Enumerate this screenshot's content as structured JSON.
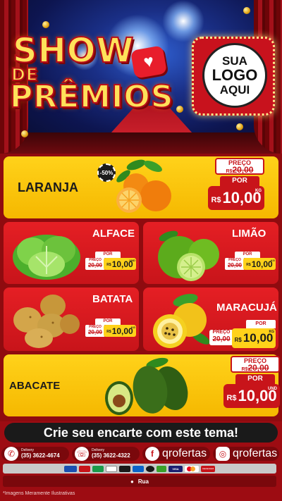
{
  "header": {
    "title_word1": "SHOW",
    "title_word2": "DE",
    "title_word3": "PRÊMIOS",
    "logo_line1": "SUA",
    "logo_line2": "LOGO",
    "logo_line3": "AQUI"
  },
  "products": [
    {
      "name": "LARANJA",
      "price_label": "PREÇO",
      "old_price": "20,00",
      "por_label": "POR",
      "currency": "R$",
      "price": "10,00",
      "unit": "KG",
      "discount": "-50%",
      "icon": "orange-icon"
    },
    {
      "name": "ALFACE",
      "price_label": "PREÇO",
      "old_price": "20,00",
      "por_label": "POR",
      "currency": "R$",
      "price": "10,00",
      "unit": "UND",
      "icon": "lettuce-icon"
    },
    {
      "name": "LIMÃO",
      "price_label": "PREÇO",
      "old_price": "20,00",
      "por_label": "POR",
      "currency": "R$",
      "price": "10,00",
      "unit": "KG",
      "icon": "lime-icon"
    },
    {
      "name": "BATATA",
      "price_label": "PREÇO",
      "old_price": "20,00",
      "por_label": "POR",
      "currency": "R$",
      "price": "10,00",
      "unit": "KG",
      "icon": "potato-icon"
    },
    {
      "name": "MARACUJÁ",
      "price_label": "PREÇO",
      "old_price": "20,00",
      "por_label": "POR",
      "currency": "R$",
      "price": "10,00",
      "unit": "KG",
      "icon": "passion-fruit-icon"
    },
    {
      "name": "ABACATE",
      "price_label": "PREÇO",
      "old_price": "20,00",
      "por_label": "POR",
      "currency": "R$",
      "price": "10,00",
      "unit": "UND",
      "icon": "avocado-icon"
    }
  ],
  "footer": {
    "cta": "Crie seu encarte com este tema!",
    "delivery_label": "Delivery",
    "phone1": "(35) 3622-4674",
    "phone2": "(35) 3622-4322",
    "facebook": "qrofertas",
    "instagram": "qrofertas",
    "payment_labels": [
      "VISA",
      "mastercard"
    ],
    "address": "Rua",
    "disclaimer": "*Imagens Meramente Ilustrativas"
  },
  "colors": {
    "brand_red": "#c8141a",
    "brand_yellow": "#ffd21a",
    "dark": "#1a1a1a"
  }
}
